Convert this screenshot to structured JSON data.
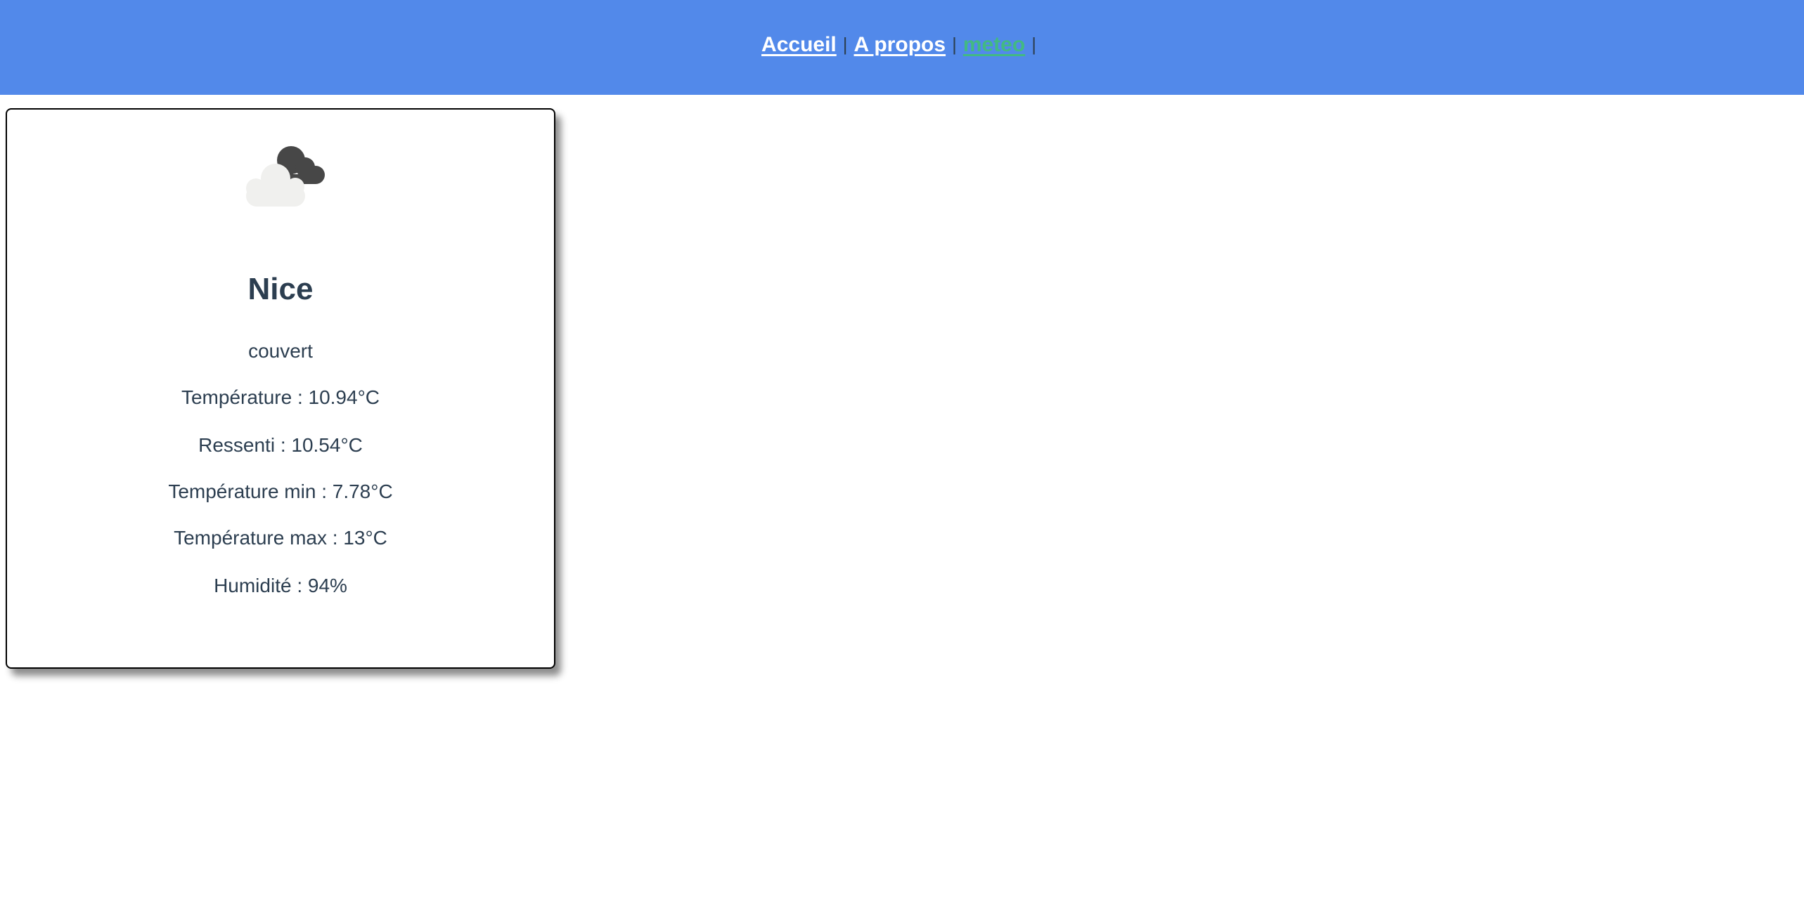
{
  "nav": {
    "items": [
      {
        "label": "Accueil",
        "active": false
      },
      {
        "label": "A propos",
        "active": false
      },
      {
        "label": "meteo",
        "active": true
      }
    ],
    "separator": "|",
    "colors": {
      "background": "#5289ea",
      "link": "#ffffff",
      "active_link": "#42b983"
    }
  },
  "weather": {
    "icon": "overcast-clouds-icon",
    "city": "Nice",
    "description": "couvert",
    "temperature": "Température : 10.94°C",
    "feels_like": "Ressenti : 10.54°C",
    "temp_min": "Température min : 7.78°C",
    "temp_max": "Température max : 13°C",
    "humidity": "Humidité : 94%"
  }
}
